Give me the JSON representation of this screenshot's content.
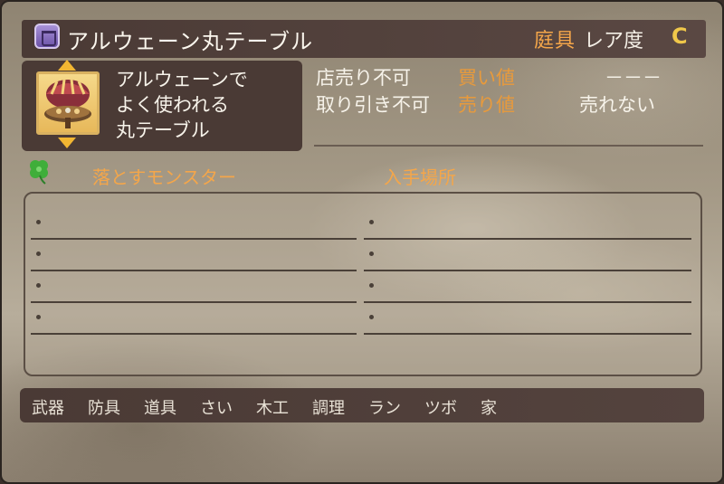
{
  "header": {
    "title": "アルウェーン丸テーブル",
    "type": "庭具",
    "rarity_label": "レア度",
    "rarity_value": "C",
    "category_icon": "furniture-category-icon"
  },
  "item": {
    "description_lines": [
      "アルウェーンで",
      "よく使われる",
      "丸テーブル"
    ],
    "thumb_icon": "round-table-item-icon"
  },
  "trade": {
    "shop_sell": "店売り不可",
    "buy_label": "買い値",
    "buy_value": "－－－",
    "trade": "取り引き不可",
    "sell_label": "売り値",
    "sell_value": "売れない"
  },
  "drops": {
    "monsters_header": "落とすモンスター",
    "location_header": "入手場所",
    "clover_icon": "clover-icon"
  },
  "footer": {
    "categories": [
      "武器",
      "防具",
      "道具",
      "さい",
      "木工",
      "調理",
      "ラン",
      "ツボ",
      "家"
    ]
  },
  "colors": {
    "accent_orange": "#f4a64a",
    "rarity_gold": "#f0c84a",
    "panel_dark": "#4a3a35"
  }
}
